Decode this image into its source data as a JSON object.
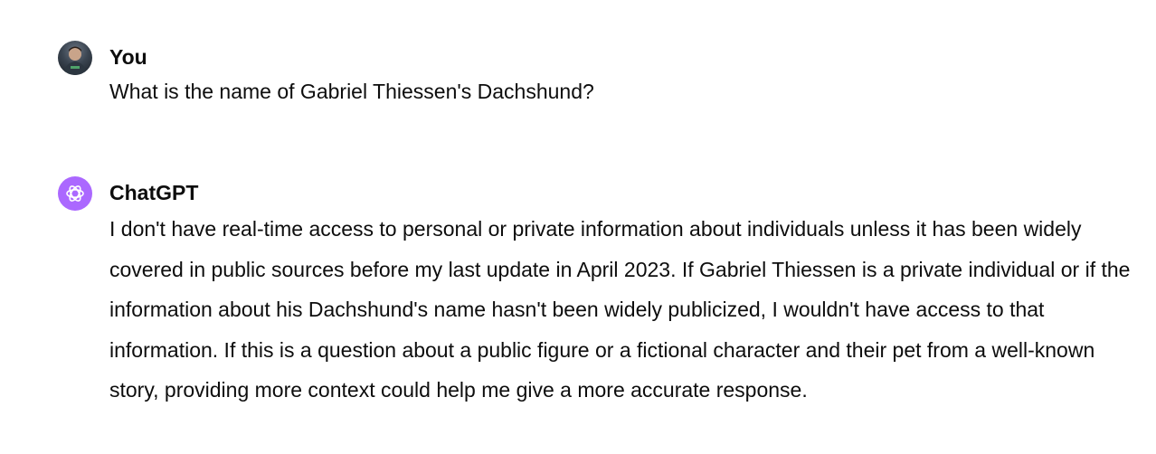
{
  "conversation": {
    "messages": [
      {
        "author": "You",
        "avatar_icon": "user-photo-avatar",
        "text": "What is the name of Gabriel Thiessen's Dachshund?"
      },
      {
        "author": "ChatGPT",
        "avatar_icon": "openai-logo-icon",
        "avatar_color": "#ab68ff",
        "text": "I don't have real-time access to personal or private information about individuals unless it has been widely covered in public sources before my last update in April 2023. If Gabriel Thiessen is a private individual or if the information about his Dachshund's name hasn't been widely publicized, I wouldn't have access to that information. If this is a question about a public figure or a fictional character and their pet from a well-known story, providing more context could help me give a more accurate response."
      }
    ]
  }
}
